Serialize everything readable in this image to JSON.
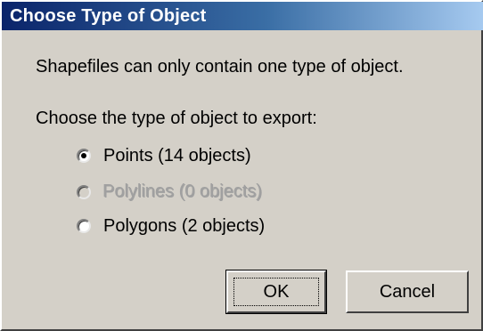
{
  "dialog": {
    "title": "Choose Type of Object",
    "message": "Shapefiles can only contain one type of object.",
    "prompt": "Choose the type of object to export:",
    "options": [
      {
        "label": "Points (14 objects)",
        "selected": true,
        "enabled": true
      },
      {
        "label": "Polylines (0 objects)",
        "selected": false,
        "enabled": false
      },
      {
        "label": "Polygons (2 objects)",
        "selected": false,
        "enabled": true
      }
    ],
    "buttons": {
      "ok": "OK",
      "cancel": "Cancel"
    }
  },
  "colors": {
    "face": "#d4d0c8",
    "titlebar_start": "#0a246a",
    "titlebar_end": "#a6caf0",
    "disabled_text": "#a0a0a0"
  }
}
